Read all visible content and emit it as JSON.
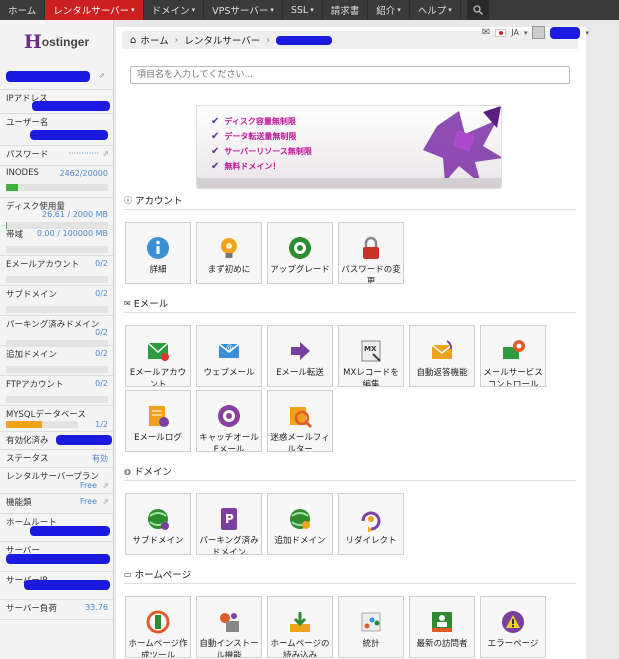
{
  "nav": {
    "items": [
      "ホーム",
      "レンタルサーバー",
      "ドメイン",
      "VPSサーバー",
      "SSL",
      "請求書",
      "紹介",
      "ヘルプ"
    ],
    "carets": [
      false,
      true,
      true,
      true,
      true,
      false,
      true,
      true
    ],
    "active_index": 1
  },
  "header": {
    "lang": "JA"
  },
  "logo": {
    "first": "H",
    "rest": "ostinger"
  },
  "sidebar": {
    "ip_label": "IPアドレス",
    "user_label": "ユーザー名",
    "password_label": "パスワード",
    "password_mask": "············",
    "inodes_label": "INODES",
    "inodes_value": "2462/20000",
    "inodes_progress": 0.12,
    "disk_label": "ディスク使用量",
    "disk_value": "26.61 / 2000 MB",
    "disk_progress": 0.013,
    "bandwidth_label": "帯域",
    "bandwidth_value": "0.00 / 100000 MB",
    "bandwidth_progress": 0,
    "email_label": "Eメールアカウント",
    "email_value": "0/2",
    "subdomain_label": "サブドメイン",
    "subdomain_value": "0/2",
    "parked_label": "パーキング済みドメイン",
    "parked_value": "0/2",
    "addon_label": "追加ドメイン",
    "addon_value": "0/2",
    "ftp_label": "FTPアカウント",
    "ftp_value": "0/2",
    "mysql_label": "MYSQLデータベース",
    "mysql_value": "1/2",
    "mysql_progress": 0.5,
    "expiry_label": "有効化済み",
    "status_label": "ステータス",
    "status_value": "有効",
    "plan_label": "レンタルサーバープラン",
    "plan_value": "Free",
    "features_label": "機能類",
    "features_value": "Free",
    "home_label": "ホームルート",
    "server_label": "サーバー",
    "server_ip_label": "サーバーIP",
    "load_label": "サーバー負荷",
    "load_value": "33.76"
  },
  "breadcrumb": {
    "home": "ホーム",
    "section": "レンタルサーバー"
  },
  "search": {
    "placeholder": "項目名を入力してください..."
  },
  "banner": {
    "lines": [
      "ディスク容量無制限",
      "データ転送量無制限",
      "サーバーリソース無制限",
      "無料ドメイン！"
    ]
  },
  "sections": {
    "account": {
      "title": "アカウント",
      "tiles": [
        {
          "label": "詳細",
          "icon": "info-icon",
          "color": "#3a8fd6"
        },
        {
          "label": "まず初めに",
          "icon": "lightbulb-icon",
          "color": "#f0a21c"
        },
        {
          "label": "アップグレード",
          "icon": "upgrade-icon",
          "color": "#2e8b2e"
        },
        {
          "label": "パスワードの変更",
          "icon": "lock-icon",
          "color": "#c8322a"
        }
      ]
    },
    "email": {
      "title": "Eメール",
      "tiles": [
        {
          "label": "Eメールアカウント",
          "icon": "email-accounts-icon",
          "color": "#2e9b3e"
        },
        {
          "label": "ウェブメール",
          "icon": "webmail-icon",
          "color": "#3a8fd6"
        },
        {
          "label": "Eメール転送",
          "icon": "forward-icon",
          "color": "#7b3fa0"
        },
        {
          "label": "MXレコードを編集",
          "icon": "mx-record-icon",
          "color": "#888888"
        },
        {
          "label": "自動返答機能",
          "icon": "autoresponder-icon",
          "color": "#f0a21c"
        },
        {
          "label": "メールサービスコントロール",
          "icon": "mail-service-icon",
          "color": "#2e9b3e"
        },
        {
          "label": "Eメールログ",
          "icon": "email-log-icon",
          "color": "#f0a21c"
        },
        {
          "label": "キャッチオールEメール",
          "icon": "catch-all-icon",
          "color": "#8a3fa0"
        },
        {
          "label": "迷惑メールフィルター",
          "icon": "spam-filter-icon",
          "color": "#e05a2a"
        }
      ]
    },
    "domain": {
      "title": "ドメイン",
      "tiles": [
        {
          "label": "サブドメイン",
          "icon": "subdomain-icon",
          "color": "#2e8b2e"
        },
        {
          "label": "パーキング済みドメイン",
          "icon": "parked-domain-icon",
          "color": "#7b3fa0"
        },
        {
          "label": "追加ドメイン",
          "icon": "addon-domain-icon",
          "color": "#2e8b2e"
        },
        {
          "label": "リダイレクト",
          "icon": "redirect-icon",
          "color": "#7b3fa0"
        }
      ]
    },
    "website": {
      "title": "ホームページ",
      "tiles": [
        {
          "label": "ホームページ作成ツール",
          "icon": "website-builder-icon",
          "color": "#e05a2a"
        },
        {
          "label": "自動インストール機能",
          "icon": "auto-installer-icon",
          "color": "#888888"
        },
        {
          "label": "ホームページの読み込み",
          "icon": "import-website-icon",
          "color": "#2e8b2e"
        },
        {
          "label": "統計",
          "icon": "statistics-icon",
          "color": "#3a8fd6"
        },
        {
          "label": "最新の訪問者",
          "icon": "visitors-icon",
          "color": "#2e8b2e"
        },
        {
          "label": "エラーページ",
          "icon": "error-page-icon",
          "color": "#7b3fa0"
        }
      ]
    }
  }
}
